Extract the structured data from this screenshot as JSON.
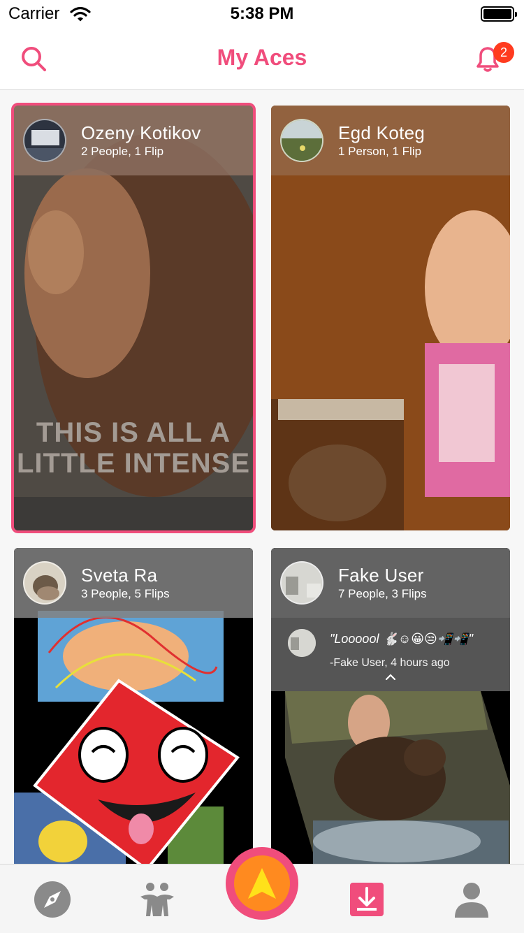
{
  "status_bar": {
    "carrier": "Carrier",
    "time": "5:38 PM"
  },
  "header": {
    "title": "My Aces",
    "notification_count": "2"
  },
  "cards": [
    {
      "name": "Ozeny Kotikov",
      "subtitle": "2 People, 1 Flip",
      "media_caption": "THIS IS ALL A LITTLE INTENSE",
      "selected": true
    },
    {
      "name": "Egd Koteg",
      "subtitle": "1 Person, 1 Flip"
    },
    {
      "name": "Sveta Ra",
      "subtitle": "3 People, 5 Flips"
    },
    {
      "name": "Fake User",
      "subtitle": "7 People, 3 Flips",
      "comment": {
        "text": "\"Loooool 🐇☺😀😒📲📲\"",
        "author": "-Fake User, 4 hours ago"
      }
    }
  ],
  "tabbar": {
    "tabs": [
      "explore-icon",
      "people-icon",
      "create-icon",
      "download-icon",
      "profile-icon"
    ]
  },
  "colors": {
    "accent": "#f04d7c",
    "fab_inner": "#ff8a1f",
    "badge": "#ff3b1f"
  }
}
